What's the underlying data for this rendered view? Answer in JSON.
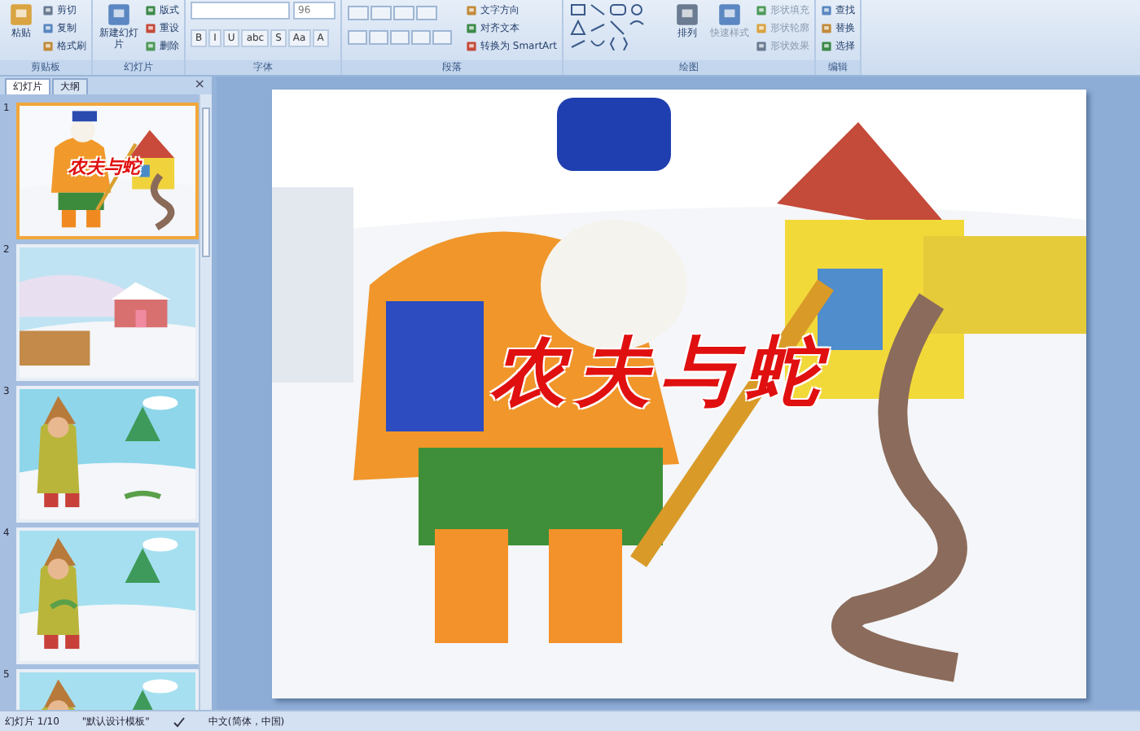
{
  "ribbon": {
    "groups": [
      {
        "label": "剪贴板",
        "large": [
          {
            "label": "粘贴"
          }
        ],
        "small": [
          {
            "label": "剪切"
          },
          {
            "label": "复制"
          },
          {
            "label": "格式刷"
          }
        ]
      },
      {
        "label": "幻灯片",
        "large": [
          {
            "label": "新建幻灯片"
          }
        ],
        "small": [
          {
            "label": "版式"
          },
          {
            "label": "重设"
          },
          {
            "label": "删除"
          }
        ]
      },
      {
        "label": "字体",
        "kind": "font",
        "font_size": "96",
        "glyphs": [
          "B",
          "I",
          "U",
          "abc",
          "S",
          "Aa",
          "A"
        ]
      },
      {
        "label": "段落",
        "kind": "paragraph",
        "small": [
          {
            "label": "文字方向"
          },
          {
            "label": "对齐文本"
          },
          {
            "label": "转换为 SmartArt"
          }
        ]
      },
      {
        "label": "绘图",
        "kind": "drawing",
        "large": [
          {
            "label": "排列"
          },
          {
            "label": "快速样式"
          }
        ],
        "small": [
          {
            "label": "形状填充"
          },
          {
            "label": "形状轮廓"
          },
          {
            "label": "形状效果"
          }
        ]
      },
      {
        "label": "编辑",
        "small": [
          {
            "label": "查找"
          },
          {
            "label": "替换"
          },
          {
            "label": "选择"
          }
        ]
      }
    ]
  },
  "sidebar": {
    "tabs": [
      {
        "label": "幻灯片",
        "selected": true
      },
      {
        "label": "大纲",
        "selected": false
      }
    ],
    "close": "×",
    "slides": [
      {
        "number": "1",
        "selected": true,
        "title": "农夫与蛇"
      },
      {
        "number": "2",
        "selected": false
      },
      {
        "number": "3",
        "selected": false
      },
      {
        "number": "4",
        "selected": false
      },
      {
        "number": "5",
        "selected": false
      }
    ]
  },
  "slide": {
    "title": "农夫与蛇"
  },
  "status_bar": {
    "items": [
      "幻灯片 1/10",
      "\"默认设计模板\"",
      "中文(简体，中国)"
    ]
  }
}
